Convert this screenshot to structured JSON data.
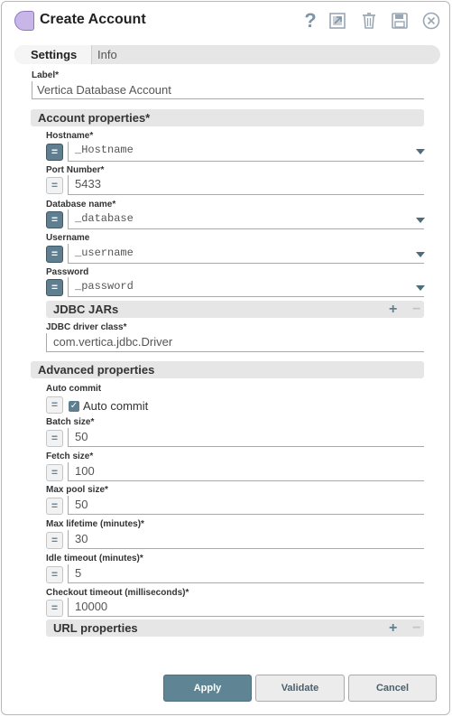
{
  "header": {
    "title": "Create Account",
    "help_glyph": "?"
  },
  "tabs": [
    {
      "label": "Settings",
      "active": true
    },
    {
      "label": "Info",
      "active": false
    }
  ],
  "label_field": {
    "label": "Label*",
    "value": "Vertica Database Account"
  },
  "account_properties": {
    "title": "Account properties*",
    "hostname": {
      "label": "Hostname*",
      "value": "_Hostname",
      "expression": true
    },
    "port": {
      "label": "Port Number*",
      "value": "5433",
      "expression": false
    },
    "database": {
      "label": "Database name*",
      "value": "_database",
      "expression": true
    },
    "username": {
      "label": "Username",
      "value": "_username",
      "expression": true
    },
    "password": {
      "label": "Password",
      "value": "_password",
      "expression": true
    },
    "jdbc_jars": {
      "title": "JDBC JARs"
    },
    "jdbc_driver": {
      "label": "JDBC driver class*",
      "value": "com.vertica.jdbc.Driver"
    }
  },
  "advanced_properties": {
    "title": "Advanced properties",
    "auto_commit": {
      "label": "Auto commit",
      "checkbox_label": "Auto commit",
      "checked": true
    },
    "batch_size": {
      "label": "Batch size*",
      "value": "50"
    },
    "fetch_size": {
      "label": "Fetch size*",
      "value": "100"
    },
    "max_pool_size": {
      "label": "Max pool size*",
      "value": "50"
    },
    "max_lifetime": {
      "label": "Max lifetime (minutes)*",
      "value": "30"
    },
    "idle_timeout": {
      "label": "Idle timeout (minutes)*",
      "value": "5"
    },
    "checkout_timeout": {
      "label": "Checkout timeout (milliseconds)*",
      "value": "10000"
    },
    "url_properties": {
      "title": "URL properties"
    }
  },
  "glyphs": {
    "eq": "=",
    "plus": "+",
    "minus": "−",
    "check": "✓"
  },
  "buttons": {
    "apply": "Apply",
    "validate": "Validate",
    "cancel": "Cancel"
  },
  "colors": {
    "accent": "#5f8494",
    "expression_on": "#5f7f90",
    "snap_icon": "#c9b6e8"
  }
}
